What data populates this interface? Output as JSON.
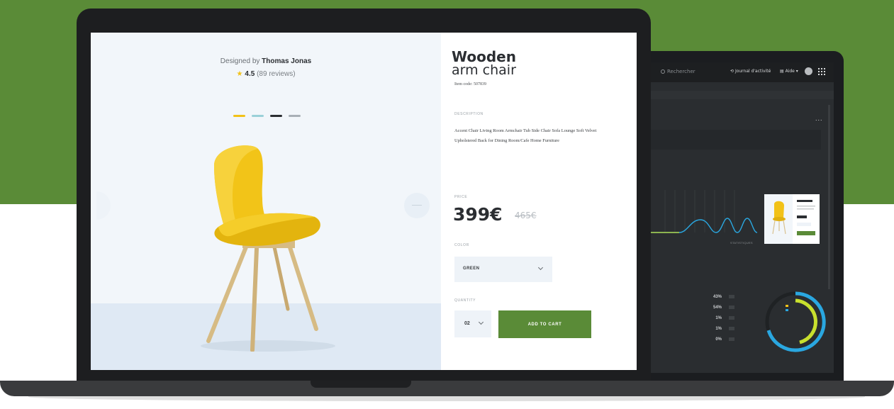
{
  "colors": {
    "brand_green": "#5a8b37",
    "background_green": "#5a8b37",
    "dark_screen": "#2a2d30",
    "chart_blue": "#2aa7e0",
    "chart_green": "#c8e02e",
    "chart_yellow": "#f2c218",
    "star": "#f2c218"
  },
  "product": {
    "designer_prefix": "Designed by",
    "designer_name": "Thomas Jonas",
    "rating": "4.5",
    "reviews": "(89 reviews)",
    "color_swatches": [
      "#f2c218",
      "#9ad0d8",
      "#2b2e32",
      "#a9b0b6"
    ],
    "title": "Wooden",
    "subtitle": "arm chair",
    "item_code": "Item code: 507839",
    "description_label": "DESCRIPTION",
    "description": "Accent Chair Living Room Armchair Tub Side Chair Sofa Lounge Soft Velvet Upholstered Back for Dining Room/Cafe Home Furniture",
    "price_label": "PRICE",
    "price": "399€",
    "old_price": "465€",
    "color_label": "COLOR",
    "color_value": "GREEN",
    "quantity_label": "QUANTITY",
    "quantity_value": "02",
    "add_to_cart_label": "ADD TO CART"
  },
  "dashboard": {
    "search_placeholder": "Rechercher",
    "journal_label": "Journal d'activité",
    "help_label": "Aide",
    "more_label": "...",
    "chart_caption": "STATISTIQUES",
    "stats": [
      "43%",
      "54%",
      "1%",
      "1%",
      "0%"
    ]
  },
  "icons": {
    "star": "star-icon",
    "arrow_left": "arrow-left-icon",
    "arrow_right": "arrow-right-icon",
    "chevron": "chevron-down-icon",
    "search": "search-icon",
    "grid": "apps-grid-icon",
    "avatar": "avatar-icon"
  }
}
